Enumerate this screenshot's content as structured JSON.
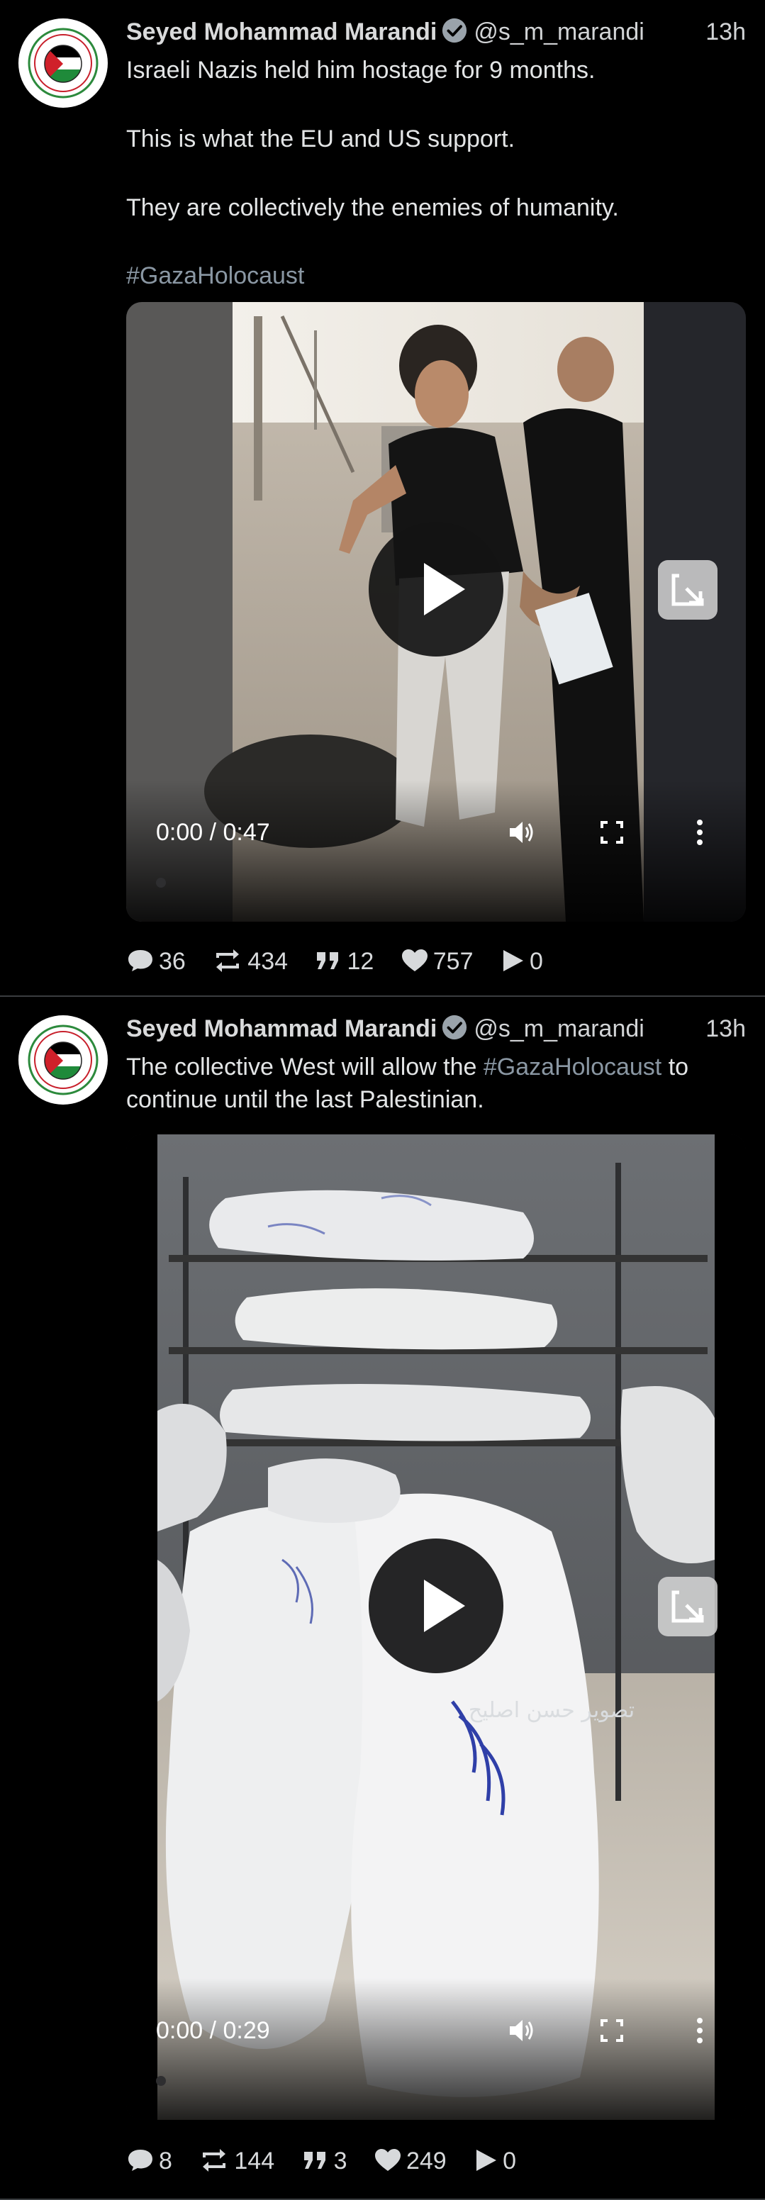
{
  "posts": [
    {
      "author_name": "Seyed Mohammad Marandi",
      "handle": "@s_m_marandi",
      "time": "13h",
      "paragraphs": [
        "Israeli Nazis held him hostage for 9 months.",
        "This is what the EU and US support.",
        "They are collectively the enemies of humanity."
      ],
      "hashtag": "#GazaHolocaust",
      "video": {
        "time_display": "0:00 / 0:47"
      },
      "stats": {
        "replies": "36",
        "reposts": "434",
        "quotes": "12",
        "likes": "757",
        "views": "0"
      }
    },
    {
      "author_name": "Seyed Mohammad Marandi",
      "handle": "@s_m_marandi",
      "time": "13h",
      "text_before": "The collective West will allow the ",
      "hashtag": "#GazaHolocaust",
      "text_after": " to continue until the last Palestinian.",
      "video": {
        "time_display": "0:00 / 0:29",
        "overlay_text": "تصوير حسن اصليح"
      },
      "stats": {
        "replies": "8",
        "reposts": "144",
        "quotes": "3",
        "likes": "249",
        "views": "0"
      }
    }
  ],
  "colors": {
    "background": "#000000",
    "text": "#e7e9ea",
    "hashtag": "#8a97a3",
    "verified": "#9aa3ab",
    "divider": "#3a3d40"
  },
  "icons": [
    "verified-icon",
    "play-icon",
    "expand-icon",
    "volume-icon",
    "fullscreen-icon",
    "more-options-icon",
    "reply-icon",
    "repost-icon",
    "quote-icon",
    "like-icon",
    "views-icon"
  ]
}
